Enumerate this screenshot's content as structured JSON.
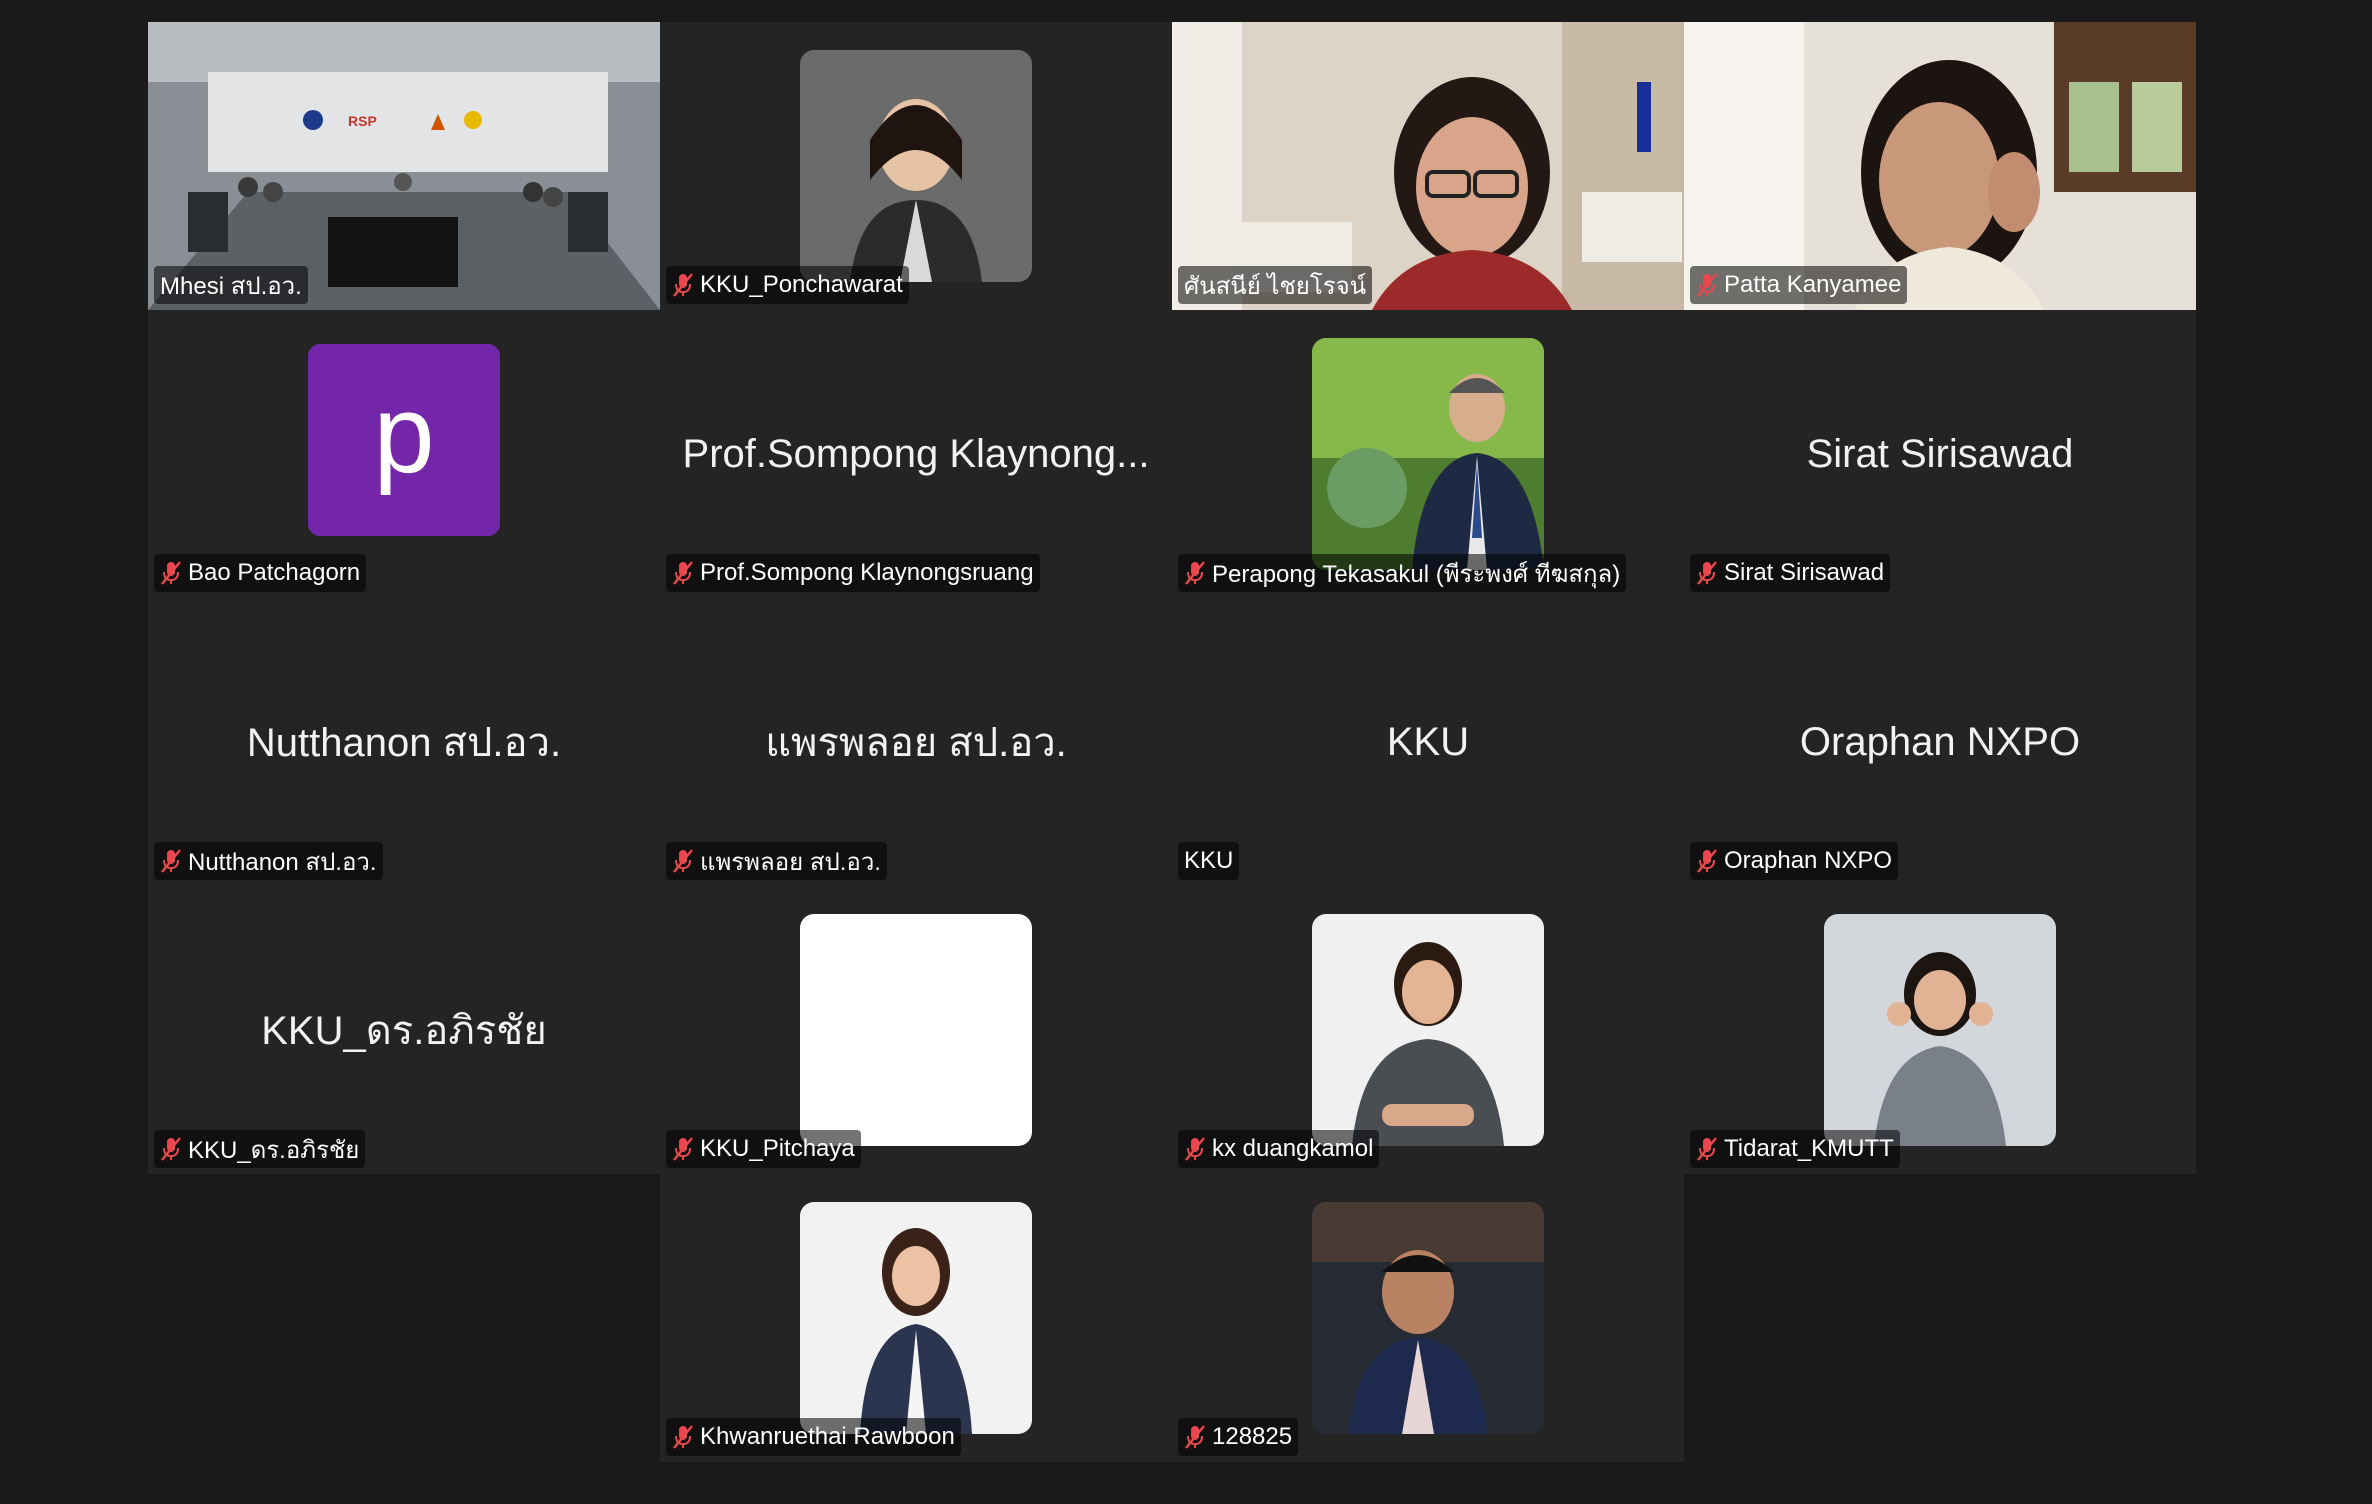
{
  "participants": [
    {
      "name": "Mhesi สป.อว.",
      "muted": false,
      "active": true
    },
    {
      "name": "KKU_Ponchawarat",
      "muted": true
    },
    {
      "name": "ศันสนีย์ ไชยโรจน์",
      "muted": false
    },
    {
      "name": "Patta Kanyamee",
      "muted": true
    },
    {
      "name": "Bao Patchagorn",
      "muted": true,
      "avatar_letter": "p"
    },
    {
      "name": "Prof.Sompong Klaynongsruang",
      "display": "Prof.Sompong Klaynong...",
      "muted": true
    },
    {
      "name": "Perapong Tekasakul (พีระพงศ์ ทีฆสกุล)",
      "muted": true
    },
    {
      "name": "Sirat Sirisawad",
      "display": "Sirat Sirisawad",
      "muted": true
    },
    {
      "name": "Nutthanon สป.อว.",
      "display": "Nutthanon สป.อว.",
      "muted": true
    },
    {
      "name": "แพรพลอย สป.อว.",
      "display": "แพรพลอย สป.อว.",
      "muted": true
    },
    {
      "name": "KKU",
      "display": "KKU",
      "muted": false
    },
    {
      "name": "Oraphan NXPO",
      "display": "Oraphan NXPO",
      "muted": true
    },
    {
      "name": "KKU_ดร.อภิรชัย",
      "display": "KKU_ดร.อภิรชัย",
      "muted": true
    },
    {
      "name": "KKU_Pitchaya",
      "muted": true
    },
    {
      "name": "kx duangkamol",
      "muted": true
    },
    {
      "name": "Tidarat_KMUTT",
      "muted": true
    },
    {
      "name": "Khwanruethai Rawboon",
      "muted": true
    },
    {
      "name": "128825",
      "muted": true
    }
  ],
  "room_logo": "RSP",
  "colors": {
    "background": "#1a1a1a",
    "tile": "#242424",
    "active_border": "#5ad45a",
    "muted_icon": "#e5484d",
    "avatar_purple": "#7326a8"
  }
}
